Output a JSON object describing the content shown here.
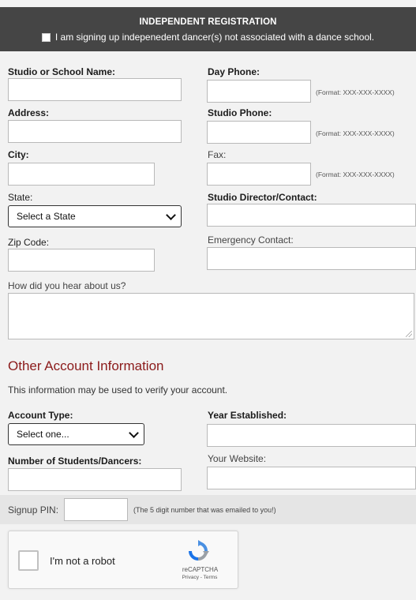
{
  "header": {
    "title": "INDEPENDENT REGISTRATION",
    "independent_label": "I am signing up indepenedent dancer(s) not associated with a dance school."
  },
  "fields": {
    "studio_name": "Studio or School Name:",
    "day_phone": "Day Phone:",
    "address": "Address:",
    "studio_phone": "Studio Phone:",
    "city": "City:",
    "fax": "Fax:",
    "state": "State:",
    "studio_director": "Studio Director/Contact:",
    "zip": "Zip Code:",
    "emergency": "Emergency Contact:",
    "hear_about": "How did you hear about us?",
    "phone_format": "(Format: XXX-XXX-XXXX)"
  },
  "state_select": {
    "value": "Select a State"
  },
  "other": {
    "title": "Other Account Information",
    "note": "This information may be used to verify your account.",
    "account_type": "Account Type:",
    "account_type_value": "Select one...",
    "year_established": "Year Established:",
    "num_students": "Number of Students/Dancers:",
    "website": "Your Website:"
  },
  "pin": {
    "label": "Signup PIN:",
    "hint": "(The 5 digit number that was emailed to you!)"
  },
  "captcha": {
    "label": "I'm not a robot",
    "brand": "reCAPTCHA",
    "links": "Privacy - Terms"
  }
}
